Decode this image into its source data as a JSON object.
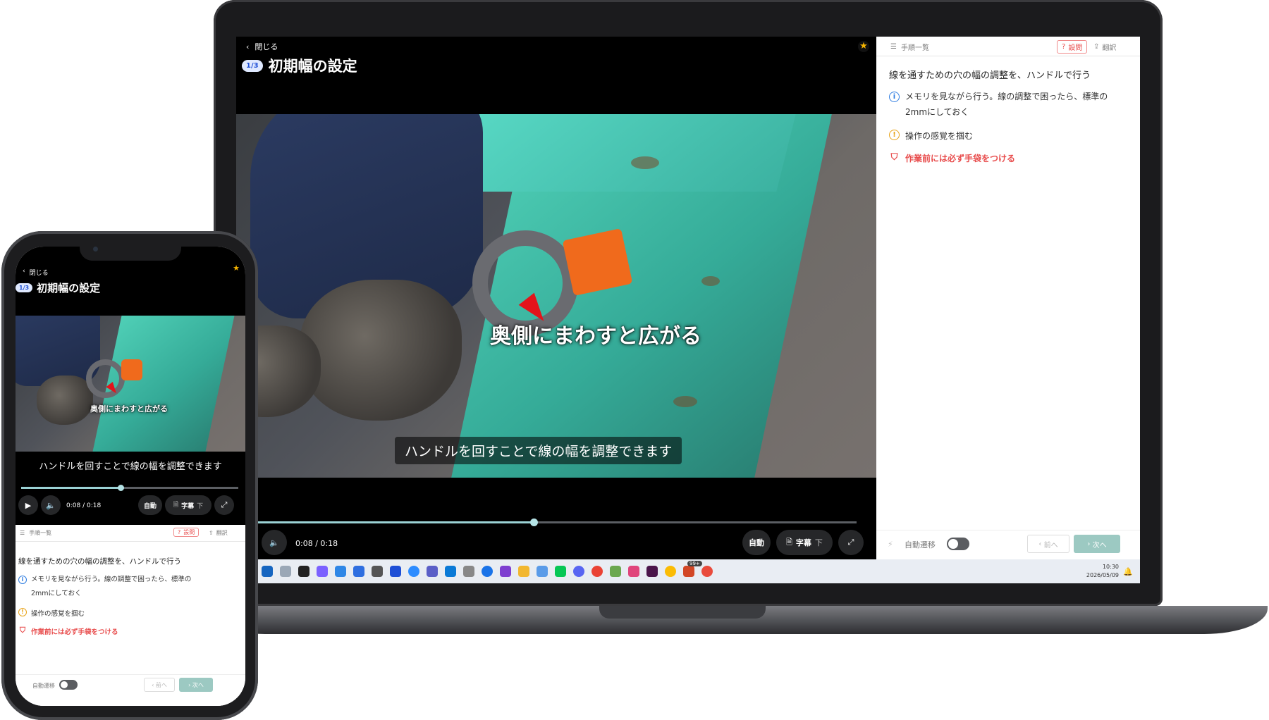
{
  "player": {
    "close_label": "閉じる",
    "step_badge": "1/3",
    "title": "初期幅の設定",
    "overlay_subtitle": "奥側にまわすと広がる",
    "caption": "ハンドルを回すことで線の幅を調整できます",
    "time": "0:08 / 0:18",
    "progress": 0.44,
    "auto_label": "自動",
    "subtitle_label": "字幕",
    "subtitle_position": "下"
  },
  "panel": {
    "steps_list_label": "手順一覧",
    "question_label": "設問",
    "translate_label": "翻訳",
    "instruction": "線を通すための穴の幅の調整を、ハンドルで行う",
    "notes": [
      {
        "type": "info",
        "text": "メモリを見ながら行う。線の調整で困ったら、標準の2mmにしておく"
      },
      {
        "type": "caution",
        "text": "操作の感覚を掴む"
      },
      {
        "type": "safety",
        "text": "作業前には必ず手袋をつける"
      }
    ],
    "auto_advance_label": "自動遷移",
    "prev_label": "前へ",
    "next_label": "次へ"
  },
  "phone_panel": {
    "info_line1": "メモリを見ながら行う。線の調整で困ったら、標準の",
    "info_line2": "2mmにしておく"
  },
  "taskbar": {
    "badge": "99+",
    "time": "10:30",
    "date": "2026/05/09"
  },
  "colors": {
    "accent_teal": "#9cc9c2",
    "danger": "#e84c4c",
    "info": "#2f7de1",
    "warning": "#e8a317"
  }
}
